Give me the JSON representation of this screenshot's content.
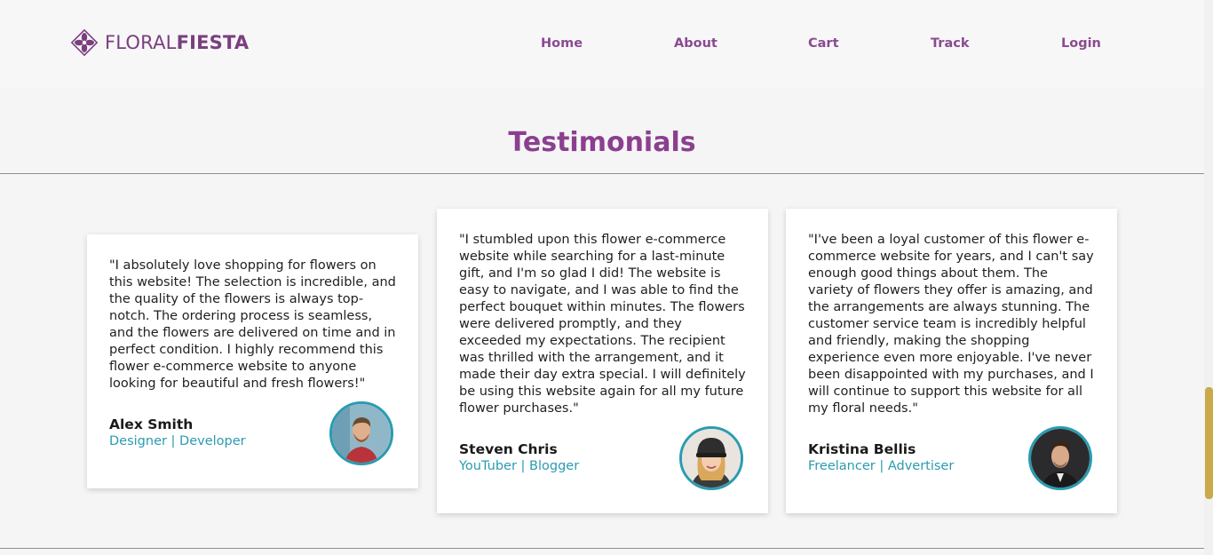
{
  "brand": {
    "name_light": "FLORAL",
    "name_bold": "FIESTA"
  },
  "nav": {
    "home": "Home",
    "about": "About",
    "cart": "Cart",
    "track": "Track",
    "login": "Login"
  },
  "section": {
    "title": "Testimonials"
  },
  "testimonials": [
    {
      "quote": "\"I absolutely love shopping for flowers on this website! The selection is incredible, and the quality of the flowers is always top-notch. The ordering process is seamless, and the flowers are delivered on time and in perfect condition. I highly recommend this flower e-commerce website to anyone looking for beautiful and fresh flowers!\"",
      "name": "Alex Smith",
      "role": "Designer | Developer"
    },
    {
      "quote": "\"I stumbled upon this flower e-commerce website while searching for a last-minute gift, and I'm so glad I did! The website is easy to navigate, and I was able to find the perfect bouquet within minutes. The flowers were delivered promptly, and they exceeded my expectations. The recipient was thrilled with the arrangement, and it made their day extra special. I will definitely be using this website again for all my future flower purchases.\"",
      "name": "Steven Chris",
      "role": "YouTuber | Blogger"
    },
    {
      "quote": "\"I've been a loyal customer of this flower e-commerce website for years, and I can't say enough good things about them. The variety of flowers they offer is amazing, and the arrangements are always stunning. The customer service team is incredibly helpful and friendly, making the shopping experience even more enjoyable. I've never been disappointed with my purchases, and I will continue to support this website for all my floral needs.\"",
      "name": "Kristina Bellis",
      "role": "Freelancer | Advertiser"
    }
  ],
  "colors": {
    "brand": "#7a3f7e",
    "nav": "#8b4a91",
    "title": "#8b3f8f",
    "accent": "#2a9bb0"
  }
}
